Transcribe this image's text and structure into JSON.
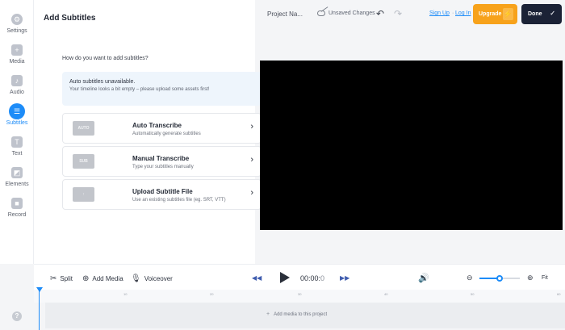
{
  "sidebar": {
    "items": [
      {
        "label": "Settings",
        "icon": "gear-icon",
        "glyph": "⚙"
      },
      {
        "label": "Media",
        "icon": "plus-icon",
        "glyph": "+"
      },
      {
        "label": "Audio",
        "icon": "music-note-icon",
        "glyph": "♪"
      },
      {
        "label": "Subtitles",
        "icon": "subtitles-icon",
        "glyph": "☰"
      },
      {
        "label": "Text",
        "icon": "text-icon",
        "glyph": "T"
      },
      {
        "label": "Elements",
        "icon": "shapes-icon",
        "glyph": "◩"
      },
      {
        "label": "Record",
        "icon": "record-icon",
        "glyph": "■"
      }
    ],
    "active": "Subtitles",
    "help_glyph": "?"
  },
  "panel": {
    "title": "Add Subtitles",
    "question": "How do you want to add subtitles?",
    "notice": {
      "title": "Auto subtitles unavailable.",
      "body": "Your timeline looks a bit empty – please upload some assets first!"
    },
    "options": [
      {
        "thumb": "AUTO",
        "title": "Auto Transcribe",
        "subtitle": "Automatically generate subtitles"
      },
      {
        "thumb": "SUB",
        "title": "Manual Transcribe",
        "subtitle": "Type your subtitles manually"
      },
      {
        "thumb": "↑",
        "title": "Upload Subtitle File",
        "subtitle": "Use an existing subtitles file (eg. SRT, VTT)"
      }
    ],
    "chevron": "›"
  },
  "topbar": {
    "project_name": "Project Na...",
    "unsaved": "Unsaved Changes",
    "undo_glyph": "↶",
    "redo_glyph": "↷",
    "signup": "Sign Up",
    "separator": "·",
    "login": "Log In",
    "upgrade": "Upgrade",
    "bolt_glyph": "⚡",
    "done": "Done",
    "check_glyph": "✓"
  },
  "timeline": {
    "split": "Split",
    "split_glyph": "✂",
    "add_media": "Add Media",
    "add_media_glyph": "⊕",
    "voiceover": "Voiceover",
    "voiceover_glyph": "🎙",
    "rewind_glyph": "◀◀",
    "forward_glyph": "▶▶",
    "timecode_main": "00:00:",
    "timecode_frac": "0",
    "speaker_glyph": "🔊",
    "zoom_out_glyph": "⊖",
    "zoom_in_glyph": "⊕",
    "zoom_level": 0.5,
    "fit": "Fit",
    "ruler_ticks": [
      "10",
      "20",
      "30",
      "40",
      "50",
      "60"
    ],
    "empty_track": "Add media to this project",
    "empty_track_glyph": "+"
  },
  "colors": {
    "accent": "#1d8cf8",
    "upgrade": "#f7a21b",
    "done": "#1b2236",
    "canvas": "#000000"
  }
}
